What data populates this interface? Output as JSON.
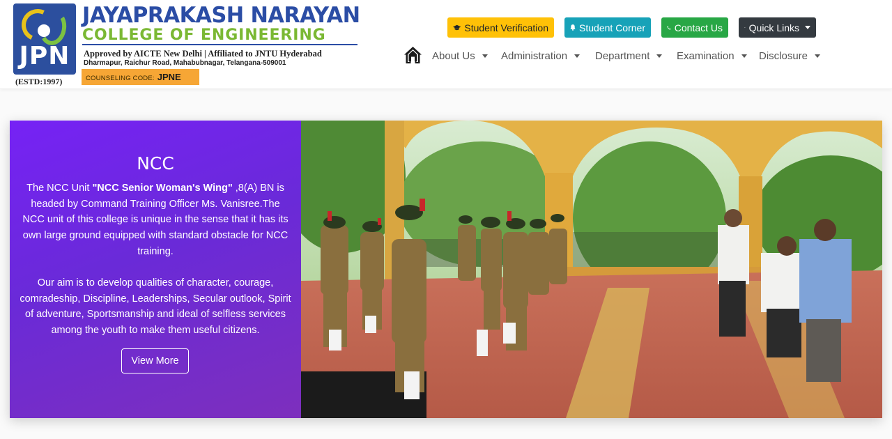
{
  "header": {
    "logo_text": "JPN",
    "estd": "(ESTD:1997)",
    "college_name_line1": "JAYAPRAKASH NARAYAN",
    "college_name_line2": "COLLEGE OF ENGINEERING",
    "approval": "Approved by AICTE New Delhi | Affiliated to JNTU Hyderabad",
    "address": "Dharmapur, Raichur Road, Mahabubnagar, Telangana-509001",
    "counseling_label": "COUNSELING CODE:",
    "counseling_code": "JPNE"
  },
  "top_buttons": {
    "student_verification": "Student Verification",
    "student_corner": "Student Corner",
    "contact_us": "Contact Us",
    "quick_links": "Quick Links"
  },
  "nav": {
    "items": [
      "About Us",
      "Administration",
      "Department",
      "Examination",
      "Disclosure"
    ]
  },
  "hero": {
    "title": "NCC",
    "para1_prefix": "The NCC Unit ",
    "para1_bold": "\"NCC Senior Woman's Wing\"",
    "para1_rest": " ,8(A) BN is headed by Command Training Officer Ms. Vanisree.The NCC unit of this college is unique in the sense that it has its own large ground equipped with standard obstacle for NCC training.",
    "para2": "Our aim is to develop qualities of character, courage, comradeship, Discipline, Leaderships, Secular outlook, Spirit of adventure, Sportsmanship and ideal of selfless services among the youth to make them useful citizens.",
    "view_more": "View More"
  },
  "colors": {
    "brand_blue": "#2b4da5",
    "brand_green": "#7ab833",
    "counseling_bg": "#f6a635",
    "btn_warning": "#ffc107",
    "btn_info": "#17a2b8",
    "btn_success": "#28a745",
    "btn_dark": "#343a40",
    "panel_purple": "#7622f5"
  },
  "icons": {
    "student_verification": "graduation-cap-icon",
    "student_corner": "bell-icon",
    "contact_us": "phone-icon",
    "quick_links": "link-icon",
    "home": "home-icon"
  }
}
